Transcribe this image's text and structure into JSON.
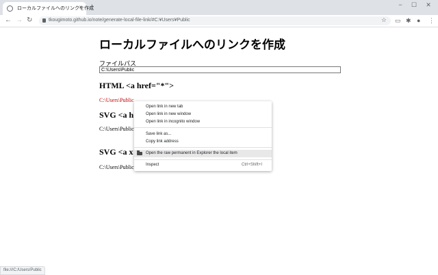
{
  "browser": {
    "tab_title": "ローカルファイルへのリンクを作成",
    "tab_close": "×",
    "new_tab": "+",
    "minimize": "−",
    "maximize": "☐",
    "close": "✕",
    "back": "←",
    "forward": "→",
    "reload": "↻",
    "url": "tkougimoto.github.io/note/generate-local-file-link/#C:¥Users¥Public",
    "star": "☆",
    "toolbar_icons": [
      "media-icon",
      "extensions-icon",
      "profile-icon",
      "menu-icon"
    ]
  },
  "page": {
    "title": "ローカルファイルへのリンクを作成",
    "path_label": "ファイルパス",
    "path_value": "C:\\Users\\Public",
    "html_heading": "HTML <a href=\"*\">",
    "html_link": "C:\\Users\\Public",
    "svg_heading_1": "SVG <a h",
    "svg_text_1": "C:\\Users\\Public",
    "svg_heading_2": "SVG <a x",
    "svg_text_2": "C:\\Users\\Public"
  },
  "context_menu": {
    "items": [
      {
        "label": "Open link in new tab"
      },
      {
        "label": "Open link in new window"
      },
      {
        "label": "Open link in incognito window"
      },
      {
        "label": "Save link as..."
      },
      {
        "label": "Copy link address"
      },
      {
        "label": "Open the raw permanent in Explorer the local item"
      },
      {
        "label": "Inspect",
        "shortcut": "Ctrl+Shift+I"
      }
    ]
  },
  "status_bar": {
    "text": "file:///C:/Users/Public"
  },
  "colors": {
    "tabstrip": "#dee1e6",
    "link_red": "#c00000",
    "menu_highlight": "#e8e8e9"
  }
}
